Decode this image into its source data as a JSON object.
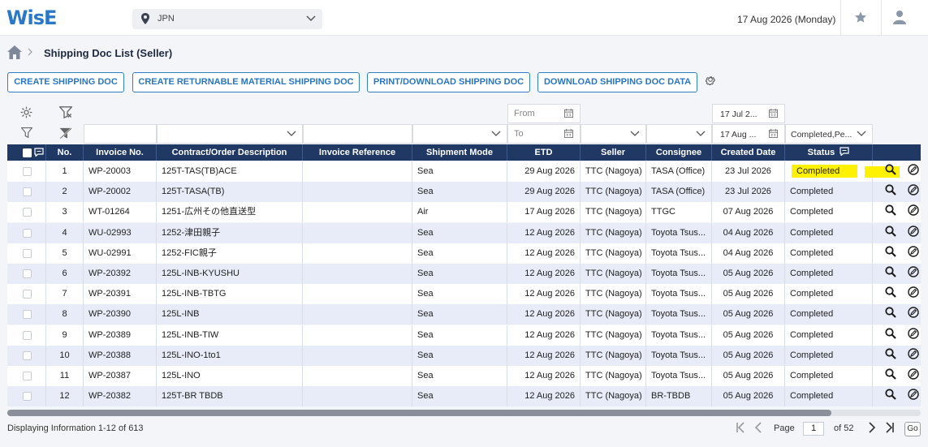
{
  "app": {
    "logo": "WisE"
  },
  "header": {
    "country": "JPN",
    "date": "17 Aug 2026 (Monday)"
  },
  "breadcrumb": {
    "title": "Shipping Doc List (Seller)"
  },
  "toolbar": {
    "create_shipping_doc": "CREATE SHIPPING DOC",
    "create_returnable": "CREATE RETURNABLE MATERIAL SHIPPING DOC",
    "print_download": "PRINT/DOWNLOAD SHIPPING DOC",
    "download_data": "DOWNLOAD SHIPPING DOC DATA"
  },
  "filters": {
    "etd_from": "From",
    "etd_to": "To",
    "created_from": "17 Jul 2...",
    "created_to": "17 Aug ...",
    "status": "Completed,Pe..."
  },
  "columns": {
    "no": "No.",
    "invoice_no": "Invoice No.",
    "contract": "Contract/Order Description",
    "invoice_ref": "Invoice Reference",
    "shipment_mode": "Shipment Mode",
    "etd": "ETD",
    "seller": "Seller",
    "consignee": "Consignee",
    "created_date": "Created Date",
    "status": "Status"
  },
  "rows": [
    {
      "no": "1",
      "invoice": "WP-20003",
      "contract": "125T-TAS(TB)ACE",
      "ref": "",
      "mode": "Sea",
      "etd": "29 Aug 2026",
      "seller": "TTC (Nagoya)",
      "consignee": "TASA (Office)",
      "created": "23 Jul 2026",
      "status": "Completed"
    },
    {
      "no": "2",
      "invoice": "WP-20002",
      "contract": "125T-TASA(TB)",
      "ref": "",
      "mode": "Sea",
      "etd": "29 Aug 2026",
      "seller": "TTC (Nagoya)",
      "consignee": "TASA (Office)",
      "created": "23 Jul 2026",
      "status": "Completed"
    },
    {
      "no": "3",
      "invoice": "WT-01264",
      "contract": "1251-広州その他直送型",
      "ref": "",
      "mode": "Air",
      "etd": "17 Aug 2026",
      "seller": "TTC (Nagoya)",
      "consignee": "TTGC",
      "created": "07 Aug 2026",
      "status": "Completed"
    },
    {
      "no": "4",
      "invoice": "WU-02993",
      "contract": "1252-津田親子",
      "ref": "",
      "mode": "Sea",
      "etd": "12 Aug 2026",
      "seller": "TTC (Nagoya)",
      "consignee": "Toyota Tsus...",
      "created": "04 Aug 2026",
      "status": "Completed"
    },
    {
      "no": "5",
      "invoice": "WU-02991",
      "contract": "1252-FIC親子",
      "ref": "",
      "mode": "Sea",
      "etd": "12 Aug 2026",
      "seller": "TTC (Nagoya)",
      "consignee": "Toyota Tsus...",
      "created": "04 Aug 2026",
      "status": "Completed"
    },
    {
      "no": "6",
      "invoice": "WP-20392",
      "contract": "125L-INB-KYUSHU",
      "ref": "",
      "mode": "Sea",
      "etd": "12 Aug 2026",
      "seller": "TTC (Nagoya)",
      "consignee": "Toyota Tsus...",
      "created": "05 Aug 2026",
      "status": "Completed"
    },
    {
      "no": "7",
      "invoice": "WP-20391",
      "contract": "125L-INB-TBTG",
      "ref": "",
      "mode": "Sea",
      "etd": "12 Aug 2026",
      "seller": "TTC (Nagoya)",
      "consignee": "Toyota Tsus...",
      "created": "05 Aug 2026",
      "status": "Completed"
    },
    {
      "no": "8",
      "invoice": "WP-20390",
      "contract": "125L-INB",
      "ref": "",
      "mode": "Sea",
      "etd": "12 Aug 2026",
      "seller": "TTC (Nagoya)",
      "consignee": "Toyota Tsus...",
      "created": "05 Aug 2026",
      "status": "Completed"
    },
    {
      "no": "9",
      "invoice": "WP-20389",
      "contract": "125L-INB-TIW",
      "ref": "",
      "mode": "Sea",
      "etd": "12 Aug 2026",
      "seller": "TTC (Nagoya)",
      "consignee": "Toyota Tsus...",
      "created": "05 Aug 2026",
      "status": "Completed"
    },
    {
      "no": "10",
      "invoice": "WP-20388",
      "contract": "125L-INO-1to1",
      "ref": "",
      "mode": "Sea",
      "etd": "12 Aug 2026",
      "seller": "TTC (Nagoya)",
      "consignee": "Toyota Tsus...",
      "created": "05 Aug 2026",
      "status": "Completed"
    },
    {
      "no": "11",
      "invoice": "WP-20387",
      "contract": "125L-INO",
      "ref": "",
      "mode": "Sea",
      "etd": "12 Aug 2026",
      "seller": "TTC (Nagoya)",
      "consignee": "Toyota Tsus...",
      "created": "05 Aug 2026",
      "status": "Completed"
    },
    {
      "no": "12",
      "invoice": "WP-20382",
      "contract": "125T-BR TBDB",
      "ref": "",
      "mode": "Sea",
      "etd": "12 Aug 2026",
      "seller": "TTC (Nagoya)",
      "consignee": "BR-TBDB",
      "created": "05 Aug 2026",
      "status": "Completed"
    }
  ],
  "footer": {
    "info": "Displaying Information 1-12 of 613",
    "page_label": "Page",
    "page_value": "1",
    "of_label": "of 52",
    "go": "Go"
  },
  "colors": {
    "header_bg": "#1f3864",
    "accent": "#2b78c9",
    "highlight": "#fff200",
    "row_alt": "#e8ecf8"
  }
}
